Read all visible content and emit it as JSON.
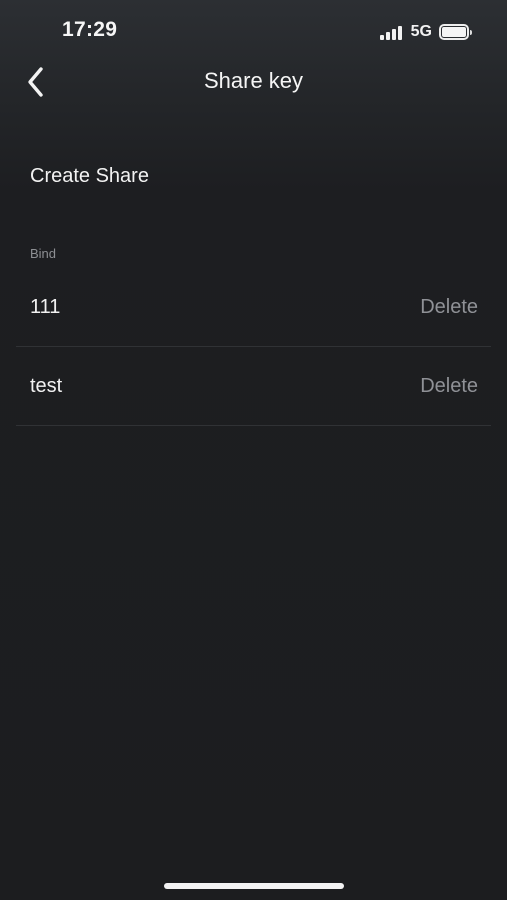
{
  "status_bar": {
    "time": "17:29",
    "network": "5G",
    "icons": {
      "signal": "cellular-signal-icon",
      "battery": "battery-icon"
    }
  },
  "header": {
    "title": "Share key",
    "back_icon": "chevron-left-icon"
  },
  "actions": {
    "create_share_label": "Create Share"
  },
  "bind_section": {
    "label": "Bind",
    "items": [
      {
        "name": "111",
        "action_label": "Delete"
      },
      {
        "name": "test",
        "action_label": "Delete"
      }
    ]
  },
  "colors": {
    "background": "#1c1d1f",
    "text_primary": "#f2f2f2",
    "text_secondary": "#8f9196",
    "divider": "#303235"
  }
}
